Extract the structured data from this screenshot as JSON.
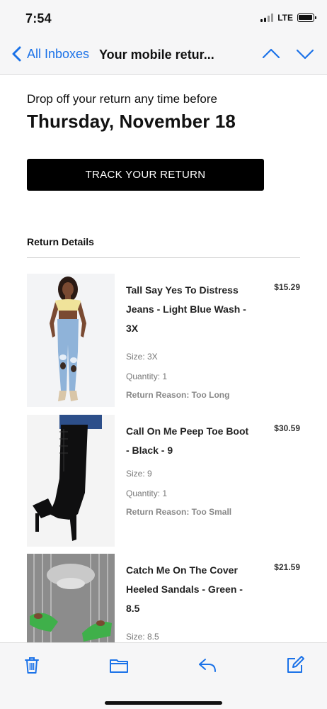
{
  "status_bar": {
    "time": "7:54",
    "network": "LTE",
    "signal_bars_active": 2,
    "signal_bars_total": 4,
    "battery_level": 0.85
  },
  "nav": {
    "back_label": "All Inboxes",
    "title": "Your mobile retur...",
    "back_icon": "chevron-left-icon",
    "prev_icon": "chevron-up-icon",
    "next_icon": "chevron-down-icon",
    "accent": "#1b72e8"
  },
  "email": {
    "dropoff_text": "Drop off your return any time before",
    "dropoff_date": "Thursday, November 18",
    "track_button": "TRACK YOUR RETURN",
    "details_heading": "Return Details",
    "items": [
      {
        "name": "Tall Say Yes To Distress Jeans - Light Blue Wash - 3X",
        "price": "$15.29",
        "size": "Size: 3X",
        "quantity": "Quantity: 1",
        "reason": "Return Reason: Too Long"
      },
      {
        "name": "Call On Me Peep Toe Boot - Black - 9",
        "price": "$30.59",
        "size": "Size: 9",
        "quantity": "Quantity: 1",
        "reason": "Return Reason: Too Small"
      },
      {
        "name": "Catch Me On The Cover Heeled Sandals - Green - 8.5",
        "price": "$21.59",
        "size": "Size: 8.5"
      }
    ]
  },
  "toolbar": {
    "icons": [
      "trash-icon",
      "folder-icon",
      "reply-icon",
      "compose-icon"
    ],
    "icon_color": "#1b72e8"
  }
}
